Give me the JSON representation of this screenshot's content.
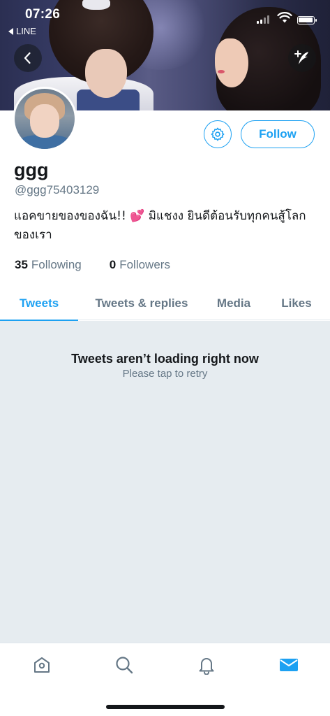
{
  "status_bar": {
    "time": "07:26",
    "back_app": "LINE"
  },
  "profile": {
    "display_name": "ggg",
    "handle": "@ggg75403129",
    "bio_before": "แอคขายของของฉัน!! ",
    "bio_emoji": "💕",
    "bio_after": " มิแชงง ยินดีต้อนรับทุกคนสู้โลกของเรา",
    "following_count": "35",
    "following_label": "Following",
    "followers_count": "0",
    "followers_label": "Followers",
    "follow_button": "Follow"
  },
  "tabs": [
    {
      "label": "Tweets",
      "active": true
    },
    {
      "label": "Tweets & replies",
      "active": false
    },
    {
      "label": "Media",
      "active": false
    },
    {
      "label": "Likes",
      "active": false
    }
  ],
  "content": {
    "error_title": "Tweets aren’t loading right now",
    "error_subtitle": "Please tap to retry"
  },
  "nav": {
    "items": [
      "home-icon",
      "search-icon",
      "notifications-icon",
      "messages-icon"
    ],
    "active": "messages-icon"
  },
  "colors": {
    "accent": "#1da1f2",
    "secondary_text": "#657786",
    "background_gray": "#e6ecf0"
  }
}
